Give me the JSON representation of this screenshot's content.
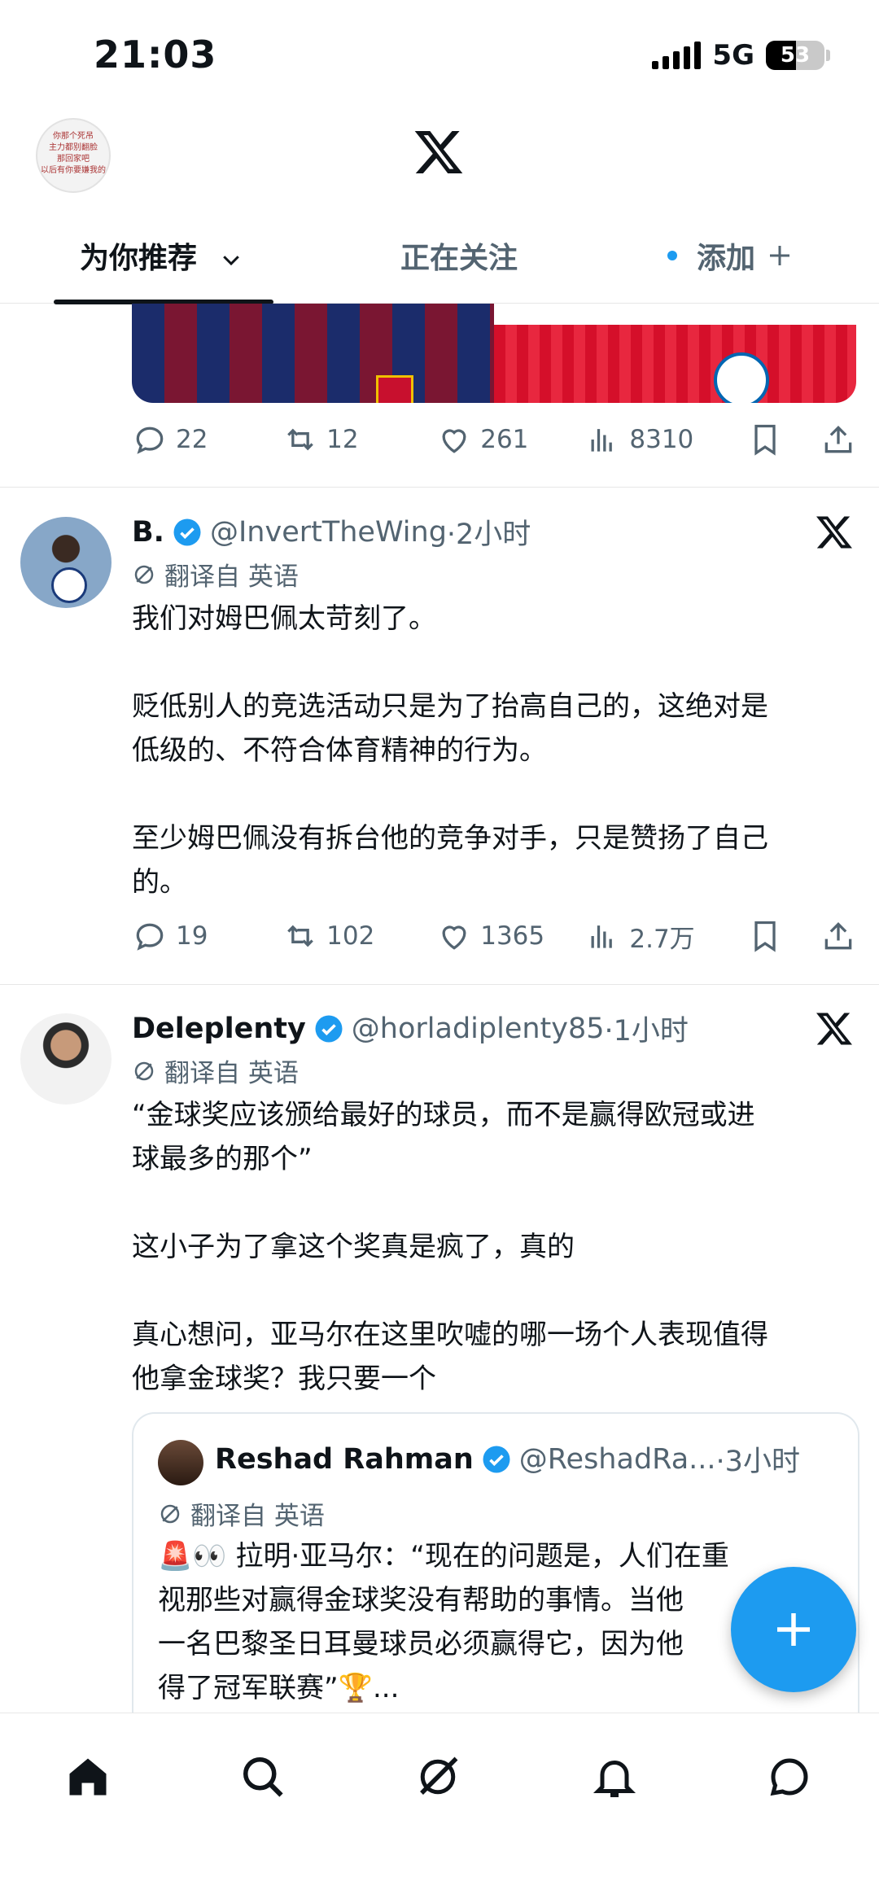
{
  "status": {
    "time": "21:03",
    "network": "5G",
    "battery": "53"
  },
  "header": {
    "avatar_text": "你那个死吊\n主力都别翻脸\n那回家吧\n以后有你要嫌我的",
    "tabs": [
      {
        "label": "为你推荐"
      },
      {
        "label": "正在关注"
      },
      {
        "label": "添加"
      }
    ]
  },
  "prev_tweet": {
    "actions": {
      "replies": "22",
      "retweets": "12",
      "likes": "261",
      "views": "8310"
    }
  },
  "tweets": [
    {
      "name": "B.",
      "handle": "@InvertTheWing",
      "time": "·2小时",
      "translate_label": "翻译自 英语",
      "body": "我们对姆巴佩太苛刻了。\n\n贬低别人的竞选活动只是为了抬高自己的，这绝对是\n低级的、不符合体育精神的行为。\n\n至少姆巴佩没有拆台他的竞争对手，只是赞扬了自己\n的。",
      "actions": {
        "replies": "19",
        "retweets": "102",
        "likes": "1365",
        "views": "2.7万"
      }
    },
    {
      "name": "Deleplenty",
      "handle": "@horladiplenty85",
      "time": "·1小时",
      "translate_label": "翻译自 英语",
      "body": "“金球奖应该颁给最好的球员，而不是赢得欧冠或进\n球最多的那个”\n\n这小子为了拿这个奖真是疯了，真的\n\n真心想问，亚马尔在这里吹嘘的哪一场个人表现值得\n他拿金球奖？我只要一个",
      "quote": {
        "name": "Reshad Rahman",
        "handle": "@ReshadRa...",
        "time": "·3小时",
        "translate_label": "翻译自 英语",
        "body": "🚨👀 拉明·亚马尔：“现在的问题是，人们在重\n视那些对赢得金球奖没有帮助的事情。当他\n一名巴黎圣日耳曼球员必须赢得它，因为他\n得了冠军联赛”🏆..."
      }
    }
  ],
  "colors": {
    "accent": "#1d9bf0",
    "text": "#0f1419",
    "muted": "#536471"
  }
}
